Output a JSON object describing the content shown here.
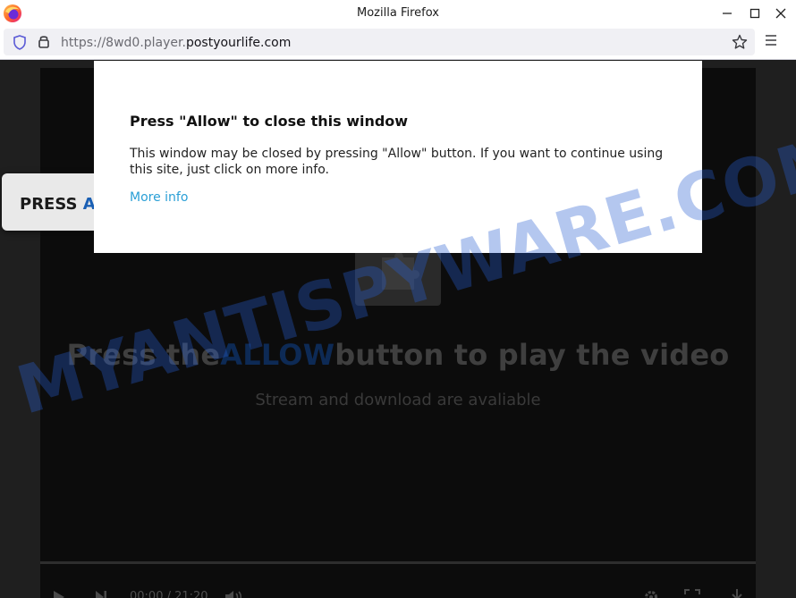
{
  "window": {
    "title": "Mozilla Firefox",
    "icon": "firefox-logo"
  },
  "navbar": {
    "url_prefix": "https://8wd0.player.",
    "url_domain": "postyourlife.com"
  },
  "page": {
    "side_tab": {
      "text_black": "PRESS ",
      "text_blue": "A"
    },
    "video": {
      "headline_before": "Press the",
      "headline_highlight": "ALLOW",
      "headline_after": "button to play the video",
      "subline": "Stream and download are avaliable",
      "time": "00:00 / 21:20"
    }
  },
  "popup": {
    "title": "Press \"Allow\" to close this window",
    "body": "This window may be closed by pressing \"Allow\" button. If you want to continue using this site, just click on more info.",
    "link": "More info"
  },
  "watermark": "MYANTISPYWARE.COM",
  "colors": {
    "accent_link": "#2a9fd6",
    "allow_highlight": "#0d2a55",
    "watermark": "#285fd2"
  }
}
